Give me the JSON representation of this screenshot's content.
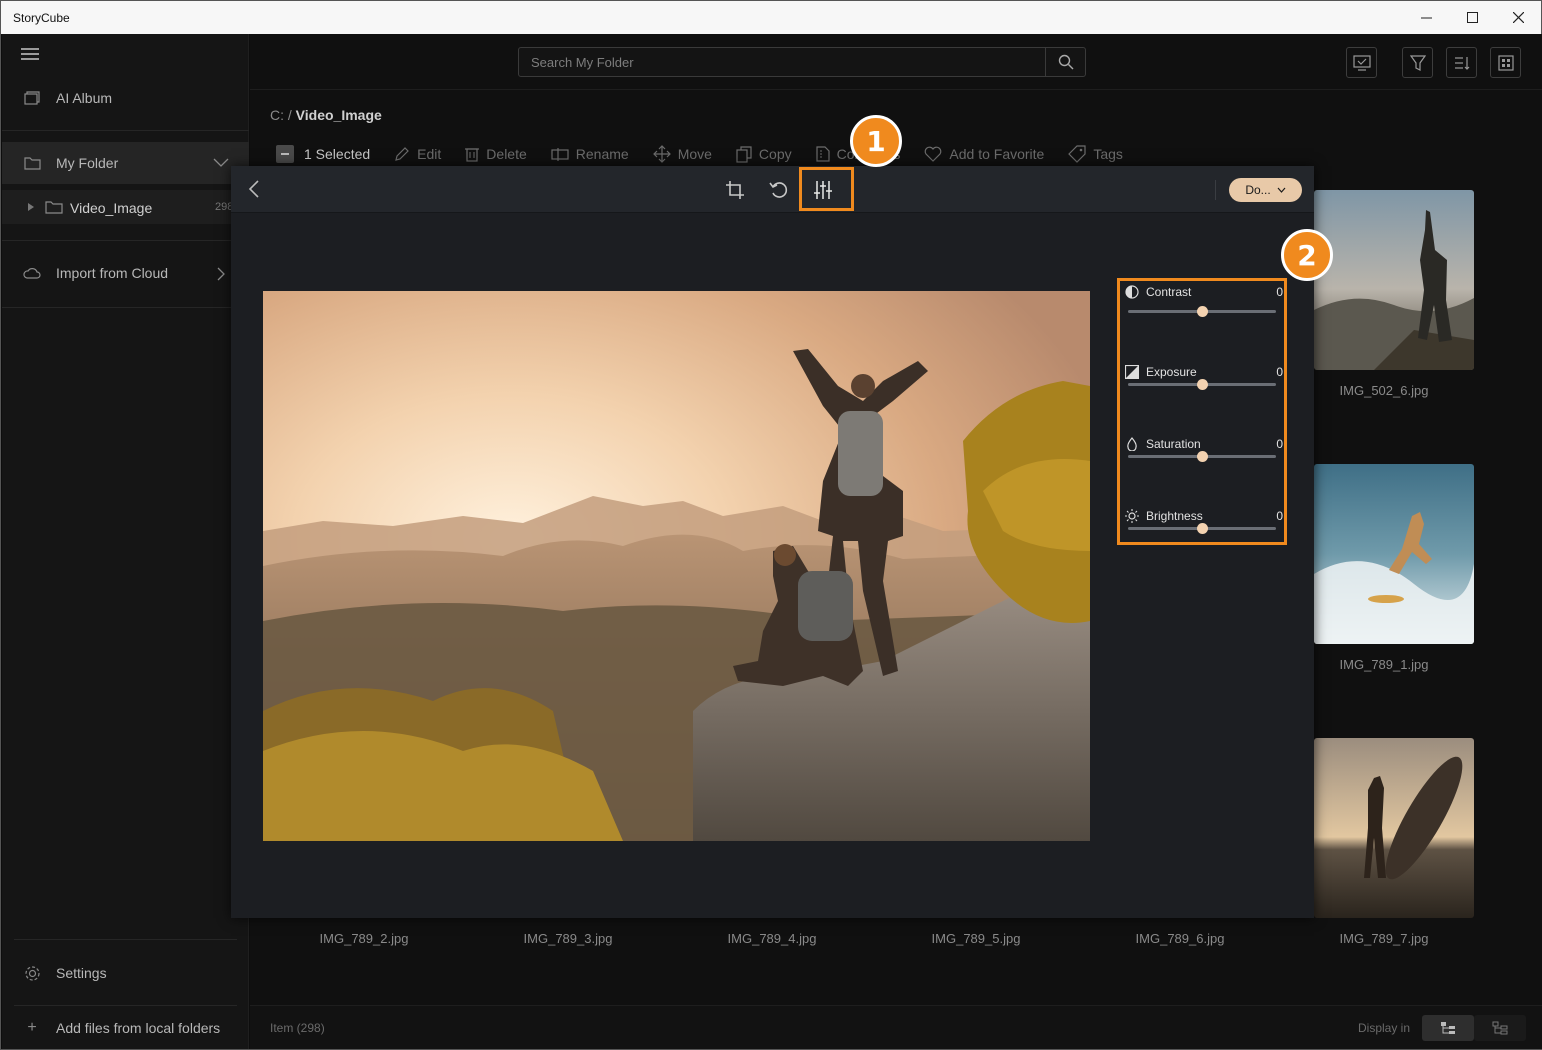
{
  "window": {
    "title": "StoryCube",
    "minimize_glyph": "—",
    "maximize_glyph": "☐",
    "close_glyph": "✕"
  },
  "sidebar": {
    "ai_album": "AI Album",
    "my_folder": "My Folder",
    "subfolder": {
      "label": "Video_Image",
      "count": "298"
    },
    "import_cloud": "Import from Cloud",
    "settings": "Settings",
    "add_files": "Add files from local folders"
  },
  "search": {
    "placeholder": "Search My Folder"
  },
  "breadcrumb": {
    "root": "C:",
    "separator": "/",
    "current": "Video_Image"
  },
  "toolbar": {
    "selected": "1 Selected",
    "edit": "Edit",
    "delete": "Delete",
    "rename": "Rename",
    "move": "Move",
    "copy": "Copy",
    "compress": "Compress",
    "add_favorite": "Add to Favorite",
    "tags": "Tags"
  },
  "thumbnails": [
    {
      "label": "IMG_502_6.jpg"
    },
    {
      "label": "IMG_789_1.jpg"
    },
    {
      "label": "IMG_789_7.jpg"
    }
  ],
  "bottom_labels": [
    "IMG_789_2.jpg",
    "IMG_789_3.jpg",
    "IMG_789_4.jpg",
    "IMG_789_5.jpg",
    "IMG_789_6.jpg"
  ],
  "status": {
    "items": "Item (298)",
    "display_in": "Display in"
  },
  "editor": {
    "done_label": "Do...",
    "adjustments": [
      {
        "label": "Contrast",
        "value": "0",
        "icon": "contrast-icon",
        "level": 0.5
      },
      {
        "label": "Exposure",
        "value": "0",
        "icon": "exposure-icon",
        "level": 0.5
      },
      {
        "label": "Saturation",
        "value": "0",
        "icon": "saturation-icon",
        "level": 0.5
      },
      {
        "label": "Brightness",
        "value": "0",
        "icon": "brightness-icon",
        "level": 0.5
      }
    ]
  },
  "callouts": [
    "1",
    "2"
  ],
  "colors": {
    "accent": "#f08a1e",
    "done_button": "#e8c9a8"
  }
}
